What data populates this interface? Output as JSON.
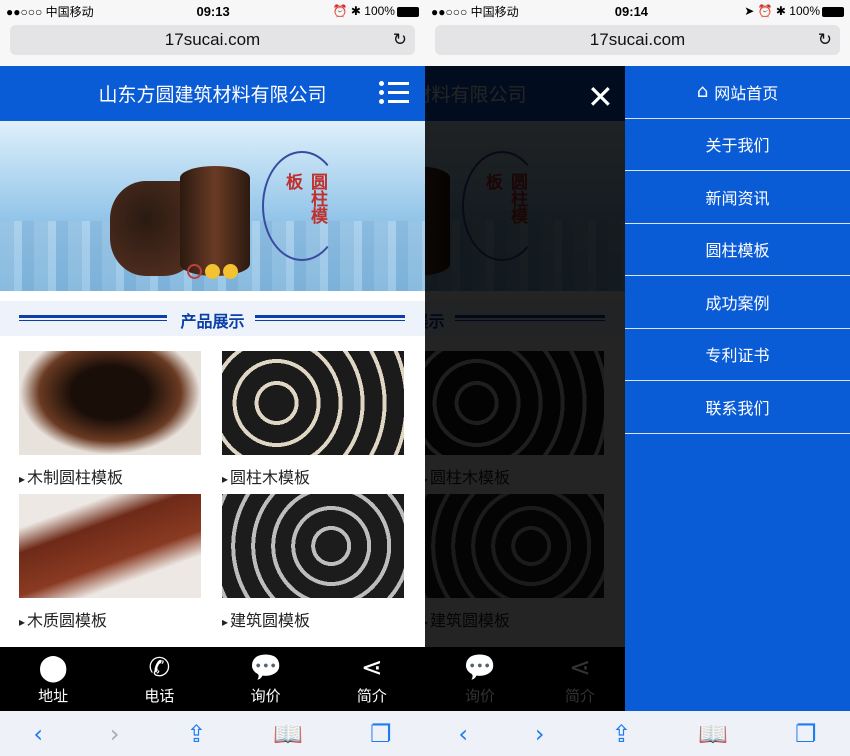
{
  "phones": [
    {
      "status": {
        "carrier": "●●○○○ 中国移动",
        "time": "09:13",
        "battery": "100%"
      },
      "url": "17sucai.com"
    },
    {
      "status": {
        "carrier": "●●○○○ 中国移动",
        "time": "09:14",
        "battery": "100%"
      },
      "url": "17sucai.com"
    }
  ],
  "header": {
    "title": "山东方圆建筑材料有限公司"
  },
  "banner": {
    "text": "圆柱模板"
  },
  "section": {
    "title": "产品展示"
  },
  "products": [
    {
      "label": "木制圆柱模板"
    },
    {
      "label": "圆柱木模板"
    },
    {
      "label": "木质圆模板"
    },
    {
      "label": "建筑圆模板"
    }
  ],
  "tabbar": [
    {
      "label": "地址",
      "icon": "map-pin-icon"
    },
    {
      "label": "电话",
      "icon": "phone-icon"
    },
    {
      "label": "询价",
      "icon": "chat-icon"
    },
    {
      "label": "简介",
      "icon": "share-icon"
    }
  ],
  "drawer": {
    "items": [
      {
        "label": "网站首页",
        "icon": "home-icon"
      },
      {
        "label": "关于我们"
      },
      {
        "label": "新闻资讯"
      },
      {
        "label": "圆柱模板"
      },
      {
        "label": "成功案例"
      },
      {
        "label": "专利证书"
      },
      {
        "label": "联系我们"
      }
    ]
  },
  "colors": {
    "brand": "#0a5bd6",
    "tabbar": "#000000",
    "ios_blue": "#1e7cf0"
  }
}
